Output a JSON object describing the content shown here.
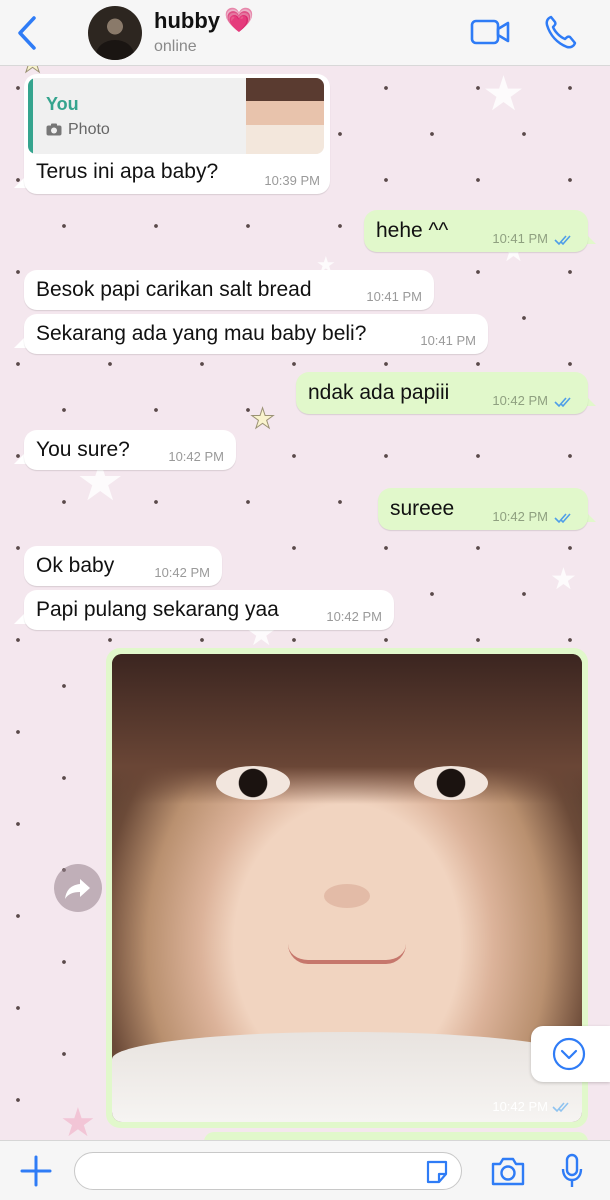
{
  "colors": {
    "accent": "#2f7cf6",
    "incoming_bubble": "#ffffff",
    "outgoing_bubble": "#e1f8cb",
    "quote_accent": "#35a48e",
    "read_ticks": "#4f9ee8",
    "wallpaper": "#f4e7ee"
  },
  "header": {
    "back_icon": "chevron-left-icon",
    "contact_name": "hubby",
    "name_emoji": "💗",
    "status": "online",
    "video_icon": "video-camera-icon",
    "call_icon": "phone-icon"
  },
  "messages": [
    {
      "direction": "in",
      "quote": {
        "author": "You",
        "type": "Photo"
      },
      "text": "Terus ini apa baby?",
      "time": "10:39 PM"
    },
    {
      "direction": "out",
      "text": "hehe ^^",
      "time": "10:41 PM",
      "read": true
    },
    {
      "direction": "in",
      "text": "Besok papi carikan salt bread",
      "time": "10:41 PM"
    },
    {
      "direction": "in",
      "text": "Sekarang ada yang mau baby beli?",
      "time": "10:41 PM"
    },
    {
      "direction": "out",
      "text": "ndak ada papiii",
      "time": "10:42 PM",
      "read": true
    },
    {
      "direction": "in",
      "text": "You sure?",
      "time": "10:42 PM"
    },
    {
      "direction": "out",
      "text": "sureee",
      "time": "10:42 PM",
      "read": true
    },
    {
      "direction": "in",
      "text": "Ok baby",
      "time": "10:42 PM"
    },
    {
      "direction": "in",
      "text": "Papi pulang sekarang yaa",
      "time": "10:42 PM"
    },
    {
      "direction": "out",
      "type": "photo",
      "time": "10:42 PM",
      "read": true
    }
  ],
  "input_bar": {
    "plus_icon": "plus-icon",
    "message_placeholder": "",
    "sticker_icon": "sticker-icon",
    "camera_icon": "camera-icon",
    "mic_icon": "microphone-icon"
  }
}
